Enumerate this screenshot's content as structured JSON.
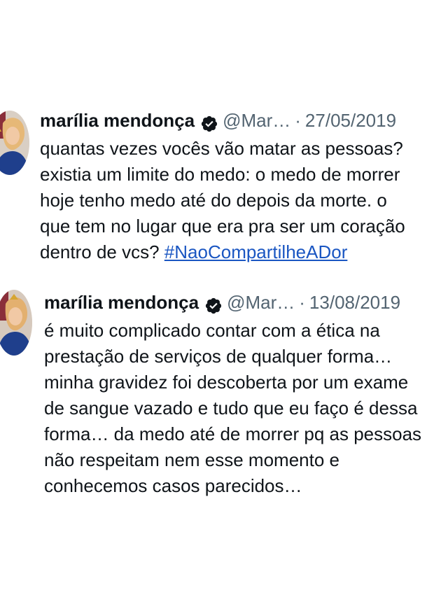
{
  "tweets": [
    {
      "display_name": "marília mendonça",
      "handle": "@Mar…",
      "separator": "·",
      "date": "27/05/2019",
      "lines": [
        "quantas vezes vocês vão matar as pessoas?",
        "existia um limite do medo: o medo de morrer",
        "hoje tenho medo até do depois da morte. o",
        "que tem no lugar que era pra ser um coração",
        "dentro de vcs?"
      ],
      "hashtag": "#NaoCompartilheADor"
    },
    {
      "display_name": "marília mendonça",
      "handle": "@Mar…",
      "separator": "·",
      "date": "13/08/2019",
      "lines": [
        "é muito complicado contar com a ética na",
        "prestação de serviços de qualquer forma…",
        "minha gravidez foi descoberta por um exame",
        "de sangue vazado e tudo que eu faço é dessa",
        "forma… da medo até de morrer pq as pessoas",
        "não respeitam nem esse momento e",
        "conhecemos casos parecidos…"
      ]
    }
  ],
  "icons": {
    "verified": "verified-badge-icon",
    "avatar": "profile-photo"
  },
  "colors": {
    "text": "#0f1419",
    "secondary": "#536471",
    "link": "#1a56c2",
    "badge": "#0f1419"
  }
}
